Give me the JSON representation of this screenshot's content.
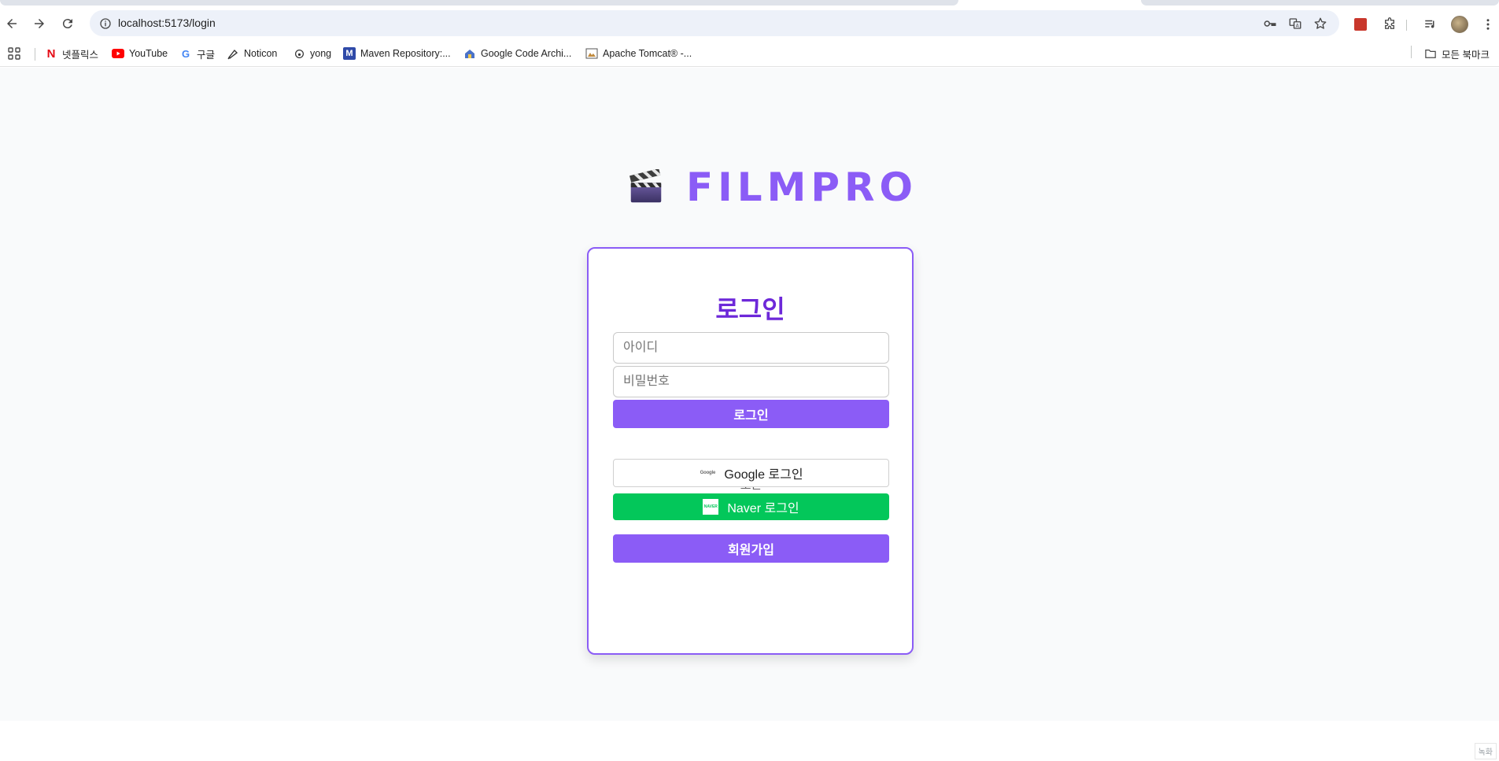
{
  "browser": {
    "url": "localhost:5173/login",
    "bookmarks": [
      {
        "label": "넷플릭스",
        "icon": "netflix-icon"
      },
      {
        "label": "YouTube",
        "icon": "youtube-icon"
      },
      {
        "label": "구글",
        "icon": "google-icon"
      },
      {
        "label": "Noticon",
        "icon": "noticon-icon"
      },
      {
        "label": "yong",
        "icon": "github-icon"
      },
      {
        "label": "Maven Repository:...",
        "icon": "maven-icon"
      },
      {
        "label": "Google Code Archi...",
        "icon": "google-code-icon"
      },
      {
        "label": "Apache Tomcat® -...",
        "icon": "tomcat-icon"
      }
    ],
    "all_bookmarks": "모든 북마크"
  },
  "brand": {
    "emoji": "🎬",
    "name": "FILMPRO"
  },
  "login": {
    "title": "로그인",
    "id_placeholder": "아이디",
    "password_placeholder": "비밀번호",
    "submit_label": "로그인",
    "divider_text": "또는",
    "google_label": "Google 로그인",
    "google_logo_text": "Google",
    "naver_label": "Naver 로그인",
    "naver_logo_text": "NAVER",
    "signup_label": "회원가입"
  },
  "corner_tag": "녹화",
  "colors": {
    "accent": "#8b5cf6",
    "title": "#6d28d9",
    "naver": "#03c75a",
    "page_bg": "#f9fafb"
  }
}
